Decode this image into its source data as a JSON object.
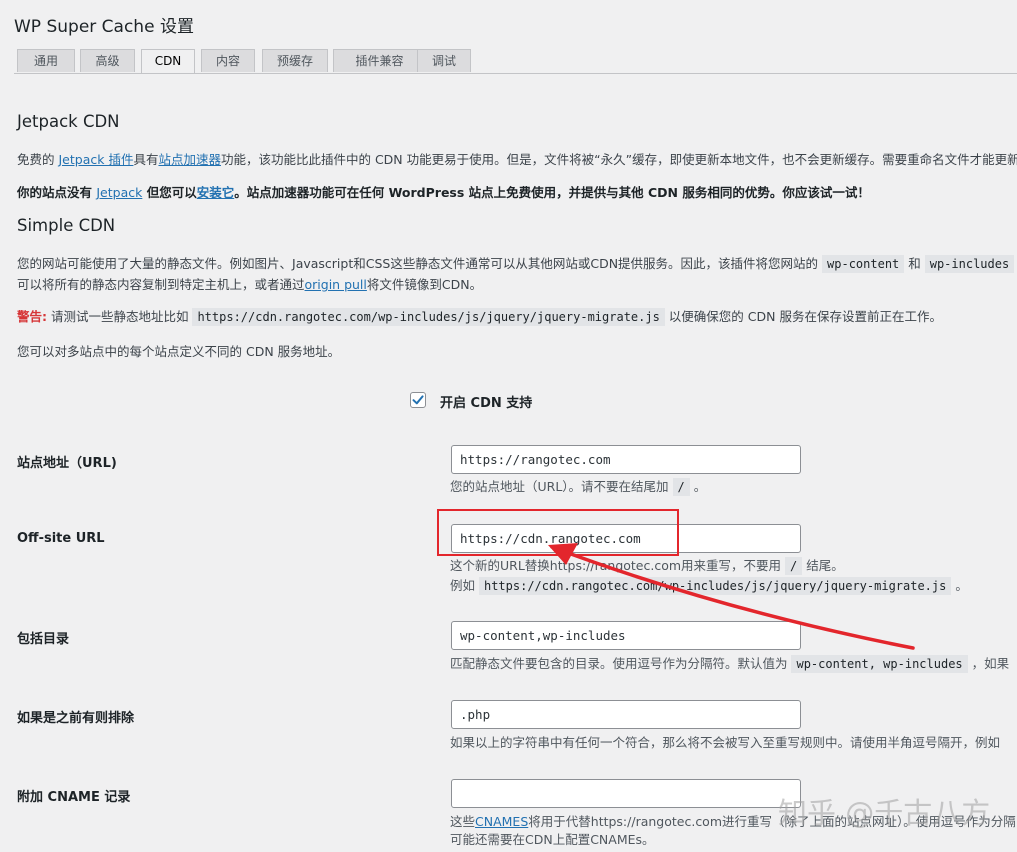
{
  "page_title": "WP Super Cache 设置",
  "tabs": [
    "通用",
    "高级",
    "CDN",
    "内容",
    "预缓存",
    "插件兼容",
    "调试"
  ],
  "active_tab": "CDN",
  "jetpack": {
    "heading": "Jetpack CDN",
    "p1_a": "免费的 ",
    "p1_link1": "Jetpack 插件",
    "p1_b": "具有",
    "p1_link2": "站点加速器",
    "p1_c": "功能，该功能比此插件中的 CDN 功能更易于使用。但是，文件将被“永久”缓存，即使更新本地文件，也不会更新缓存。需要重命名文件才能更新。",
    "p2_a": "你的站点没有 ",
    "p2_link1": "Jetpack",
    "p2_b": " 但您可以",
    "p2_link2": "安装它",
    "p2_c": "。站点加速器功能可在任何 WordPress 站点上免费使用，并提供与其他 CDN 服务相同的优势。你应该试一试！"
  },
  "simple": {
    "heading": "Simple CDN",
    "p1_a": "您的网站可能使用了大量的静态文件。例如图片、Javascript和CSS这些静态文件通常可以从其他网站或CDN提供服务。因此，该插件将您网站的 ",
    "p1_code1": "wp-content",
    "p1_b": " 和 ",
    "p1_code2": "wp-includes",
    "p2_a": "可以将所有的静态内容复制到特定主机上，或者通过",
    "p2_link": "origin pull",
    "p2_b": "将文件镜像到CDN。",
    "warn_label": "警告:",
    "warn_a": " 请测试一些静态地址比如 ",
    "warn_code": "https://cdn.rangotec.com/wp-includes/js/jquery/jquery-migrate.js",
    "warn_b": " 以便确保您的 CDN 服务在保存设置前正在工作。",
    "p3": "您可以对多站点中的每个站点定义不同的 CDN 服务地址。"
  },
  "enable": {
    "label": "开启 CDN 支持",
    "checked": true
  },
  "fields": {
    "site_url": {
      "label": "站点地址（URL)",
      "value": "https://rangotec.com",
      "desc_a": "您的站点地址（URL）。请不要在结尾加 ",
      "desc_code": "/",
      "desc_b": " 。"
    },
    "offsite_url": {
      "label": "Off-site URL",
      "value": "https://cdn.rangotec.com",
      "desc1_a": "这个新的URL替换https://rangotec.com用来重写，不要用 ",
      "desc1_code": "/",
      "desc1_b": " 结尾。",
      "desc2_a": "例如 ",
      "desc2_code": "https://cdn.rangotec.com/wp-includes/js/jquery/jquery-migrate.js",
      "desc2_b": " 。"
    },
    "include_dirs": {
      "label": "包括目录",
      "value": "wp-content,wp-includes",
      "desc_a": "匹配静态文件要包含的目录。使用逗号作为分隔符。默认值为 ",
      "desc_code": "wp-content, wp-includes",
      "desc_b": " ，如果"
    },
    "exclude": {
      "label": "如果是之前有则排除",
      "value": ".php",
      "desc": "如果以上的字符串中有任何一个符合，那么将不会被写入至重写规则中。请使用半角逗号隔开，例如"
    },
    "cname": {
      "label": "附加 CNAME 记录",
      "value": "",
      "desc1_a": "这些",
      "desc1_link": "CNAMES",
      "desc1_b": "将用于代替https://rangotec.com进行重写（除了上面的站点网址）。使用逗号作为分隔",
      "desc2": "可能还需要在CDN上配置CNAMEs。"
    }
  },
  "watermark": "知乎 @千古八方",
  "colors": {
    "highlight": "#e3262c",
    "link": "#2271b1",
    "warning": "#d63638"
  }
}
